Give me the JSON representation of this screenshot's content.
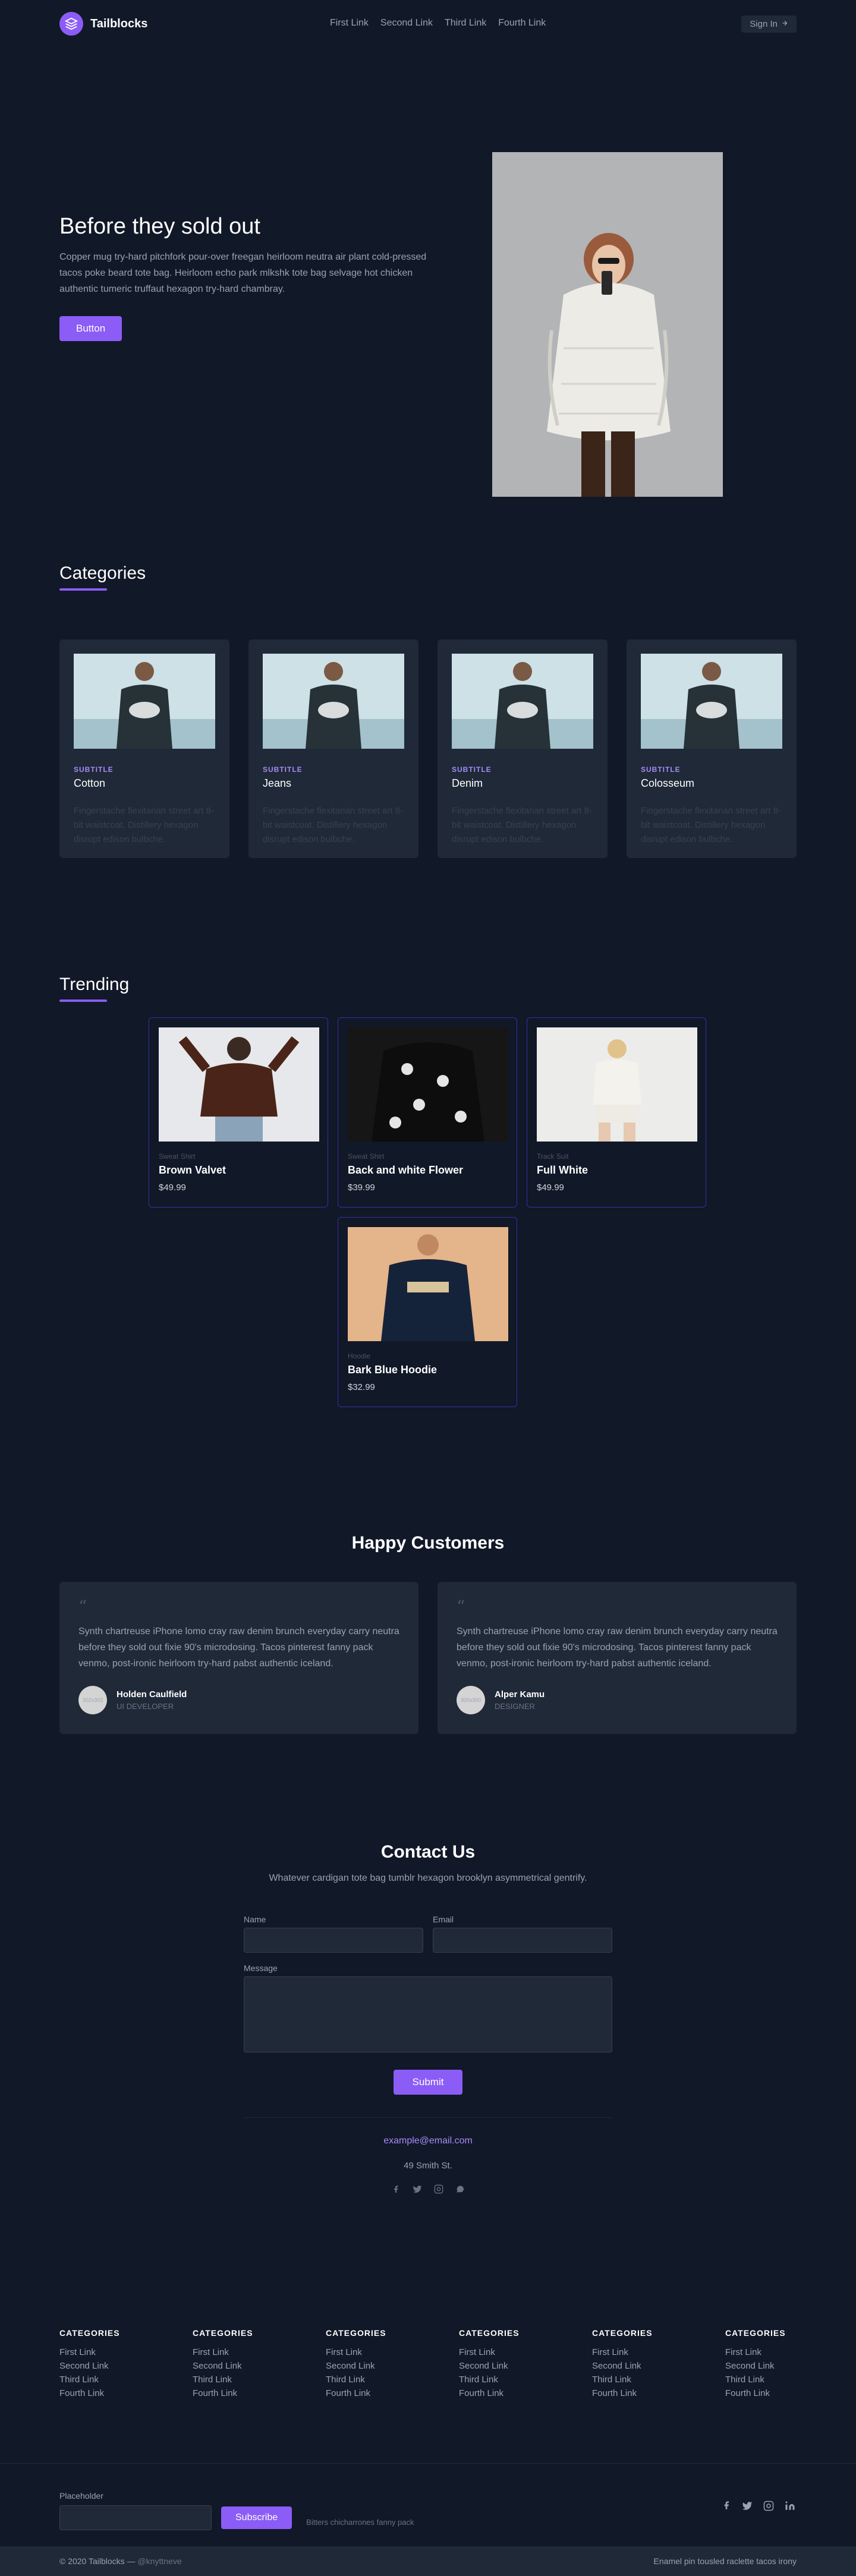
{
  "header": {
    "brand": "Tailblocks",
    "nav": [
      "First Link",
      "Second Link",
      "Third Link",
      "Fourth Link"
    ],
    "signin": "Sign In"
  },
  "hero": {
    "title": "Before they sold out",
    "description": "Copper mug try-hard pitchfork pour-over freegan heirloom neutra air plant cold-pressed tacos poke beard tote bag. Heirloom echo park mlkshk tote bag selvage hot chicken authentic tumeric truffaut hexagon try-hard chambray.",
    "button": "Button"
  },
  "categories": {
    "title": "Categories",
    "items": [
      {
        "subtitle": "SUBTITLE",
        "title": "Cotton",
        "desc": "Fingerstache flexitarian street art 8-bit waistcoat. Distillery hexagon disrupt edison bulbche."
      },
      {
        "subtitle": "SUBTITLE",
        "title": "Jeans",
        "desc": "Fingerstache flexitarian street art 8-bit waistcoat. Distillery hexagon disrupt edison bulbche."
      },
      {
        "subtitle": "SUBTITLE",
        "title": "Denim",
        "desc": "Fingerstache flexitarian street art 8-bit waistcoat. Distillery hexagon disrupt edison bulbche."
      },
      {
        "subtitle": "SUBTITLE",
        "title": "Colosseum",
        "desc": "Fingerstache flexitarian street art 8-bit waistcoat. Distillery hexagon disrupt edison bulbche."
      }
    ]
  },
  "trending": {
    "title": "Trending",
    "products": [
      {
        "category": "Sweat Shirt",
        "name": "Brown Valvet",
        "price": "$49.99"
      },
      {
        "category": "Sweat Shirt",
        "name": "Back and white Flower",
        "price": "$39.99"
      },
      {
        "category": "Track Suit",
        "name": "Full White",
        "price": "$49.99"
      },
      {
        "category": "Hoodie",
        "name": "Bark Blue Hoodie",
        "price": "$32.99"
      }
    ]
  },
  "customers": {
    "title": "Happy Customers",
    "items": [
      {
        "text": "Synth chartreuse iPhone lomo cray raw denim brunch everyday carry neutra before they sold out fixie 90's microdosing. Tacos pinterest fanny pack venmo, post-ironic heirloom try-hard pabst authentic iceland.",
        "name": "Holden Caulfield",
        "role": "UI DEVELOPER",
        "avatar": "302x302"
      },
      {
        "text": "Synth chartreuse iPhone lomo cray raw denim brunch everyday carry neutra before they sold out fixie 90's microdosing. Tacos pinterest fanny pack venmo, post-ironic heirloom try-hard pabst authentic iceland.",
        "name": "Alper Kamu",
        "role": "DESIGNER",
        "avatar": "300x300"
      }
    ]
  },
  "contact": {
    "title": "Contact Us",
    "description": "Whatever cardigan tote bag tumblr hexagon brooklyn asymmetrical gentrify.",
    "name_label": "Name",
    "email_label": "Email",
    "message_label": "Message",
    "submit": "Submit",
    "email": "example@email.com",
    "address": "49 Smith St."
  },
  "footer": {
    "columns": [
      {
        "heading": "CATEGORIES",
        "links": [
          "First Link",
          "Second Link",
          "Third Link",
          "Fourth Link"
        ]
      },
      {
        "heading": "CATEGORIES",
        "links": [
          "First Link",
          "Second Link",
          "Third Link",
          "Fourth Link"
        ]
      },
      {
        "heading": "CATEGORIES",
        "links": [
          "First Link",
          "Second Link",
          "Third Link",
          "Fourth Link"
        ]
      },
      {
        "heading": "CATEGORIES",
        "links": [
          "First Link",
          "Second Link",
          "Third Link",
          "Fourth Link"
        ]
      },
      {
        "heading": "CATEGORIES",
        "links": [
          "First Link",
          "Second Link",
          "Third Link",
          "Fourth Link"
        ]
      },
      {
        "heading": "CATEGORIES",
        "links": [
          "First Link",
          "Second Link",
          "Third Link",
          "Fourth Link"
        ]
      }
    ],
    "newsletter_label": "Placeholder",
    "subscribe": "Subscribe",
    "newsletter_note": "Bitters chicharrones fanny pack",
    "copyright": "© 2020 Tailblocks —",
    "handle": "@knyttneve",
    "tagline": "Enamel pin tousled raclette tacos irony"
  },
  "colors": {
    "accent": "#8b5cf6",
    "background": "#111827",
    "card": "#1f2937"
  }
}
